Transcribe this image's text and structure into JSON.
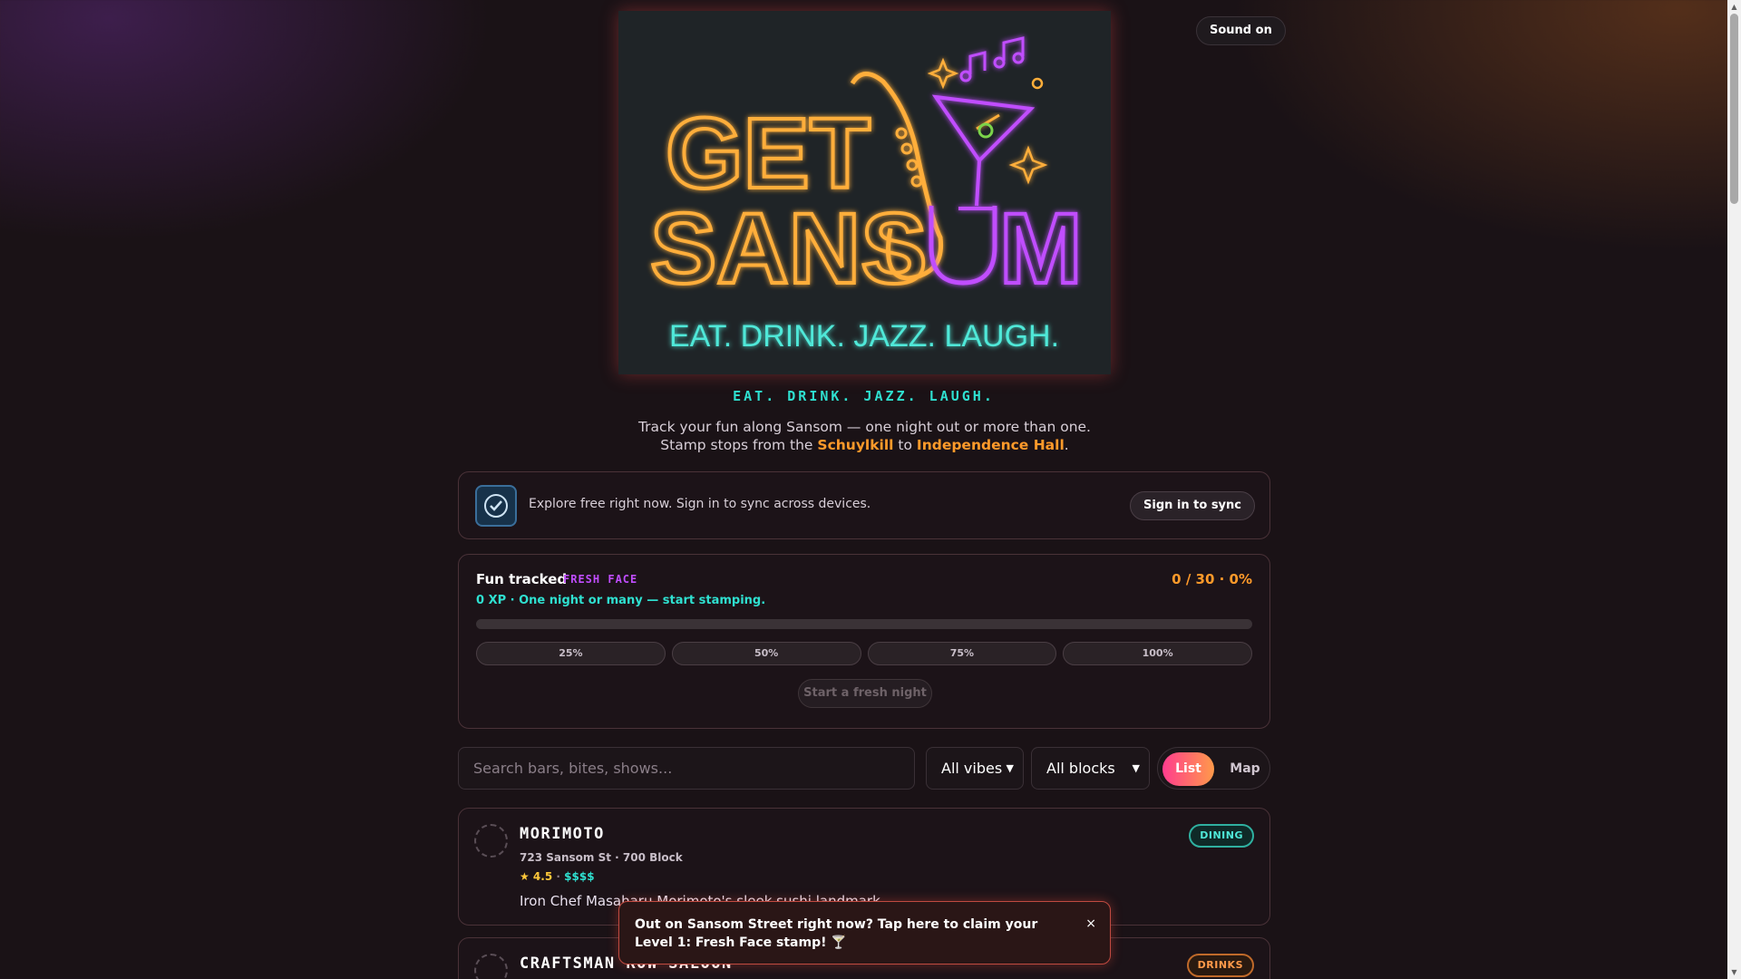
{
  "header": {
    "sound_label": "Sound on"
  },
  "hero": {
    "logo_line1": "GET",
    "logo_line2_a": "SANS",
    "logo_line2_b": "M",
    "logo_tagline": "EAT. DRINK. JAZZ. LAUGH."
  },
  "tagline": "EAT. DRINK. JAZZ. LAUGH.",
  "intro": {
    "text_before": "Track your fun along Sansom — one night out or more than one. Stamp stops from the ",
    "highlight1": "Schuylkill",
    "text_mid": " to ",
    "highlight2": "Independence Hall",
    "text_after": "."
  },
  "signin": {
    "message": "Explore free right now. Sign in to sync across devices.",
    "button": "Sign in to sync"
  },
  "progress": {
    "title": "Fun tracked",
    "badge": "FRESH FACE",
    "count": "0 / 30 · 0%",
    "xp_line": "0 XP · One night or many — start stamping.",
    "fraction": 0,
    "milestones": [
      "25%",
      "50%",
      "75%",
      "100%"
    ],
    "reset_button": "Start a fresh night"
  },
  "filters": {
    "search_placeholder": "Search bars, bites, shows...",
    "vibes_selected": "All vibes",
    "blocks_selected": "All blocks",
    "view_list": "List",
    "view_map": "Map"
  },
  "venues": [
    {
      "name": "Morimoto",
      "address": "723 Sansom St · 700 Block",
      "rating": "★ 4.5",
      "price": "$$$$",
      "description": "Iron Chef Masaharu Morimoto's sleek sushi landmark.",
      "tag": "DINING"
    },
    {
      "name": "Craftsman Row Saloon",
      "tag": "DRINKS"
    }
  ],
  "toast": {
    "message": "Out on Sansom Street right now? Tap here to claim your Level 1: Fresh Face stamp! 🍸",
    "close": "×"
  },
  "colors": {
    "accent_orange": "#ff9a2a",
    "accent_teal": "#2fe0d0",
    "accent_purple": "#c04dff",
    "accent_pink": "#ff3c8e"
  }
}
